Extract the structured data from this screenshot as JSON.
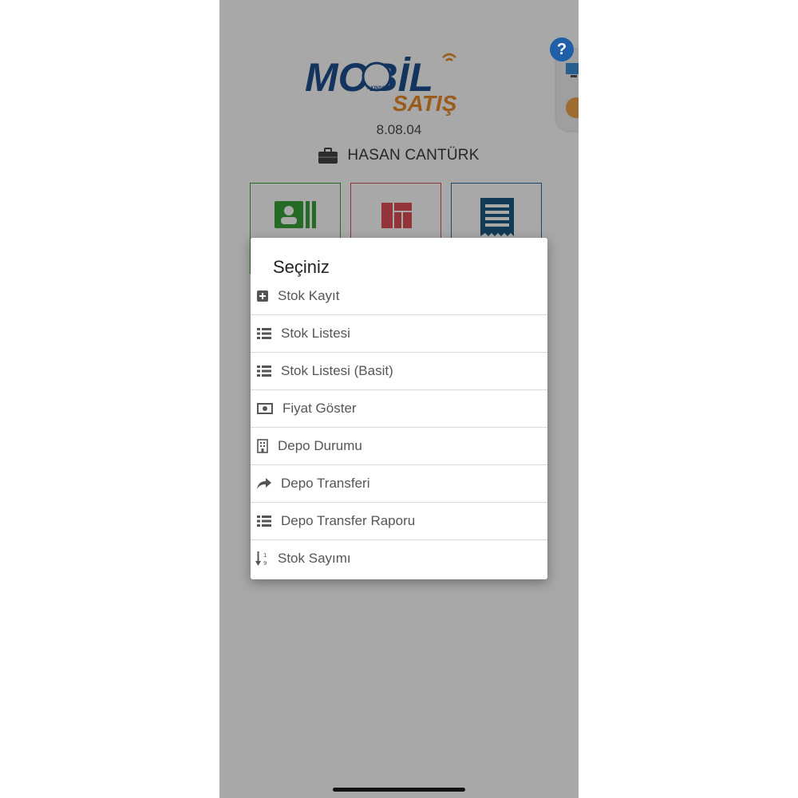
{
  "app": {
    "logo_word1": "MOBİL",
    "logo_word2": "SATIŞ",
    "logo_brand": "AKINSOFT",
    "version": "8.08.04",
    "user_name": "HASAN CANTÜRK",
    "help_label": "?"
  },
  "colors": {
    "logo_blue": "#1e4f8c",
    "logo_orange": "#e98c2a",
    "tile_green": "#39a33a",
    "tile_red": "#e0505a",
    "tile_blue": "#2b6ea8"
  },
  "tiles": [
    {
      "icon": "contact-card-icon"
    },
    {
      "icon": "dashboard-icon"
    },
    {
      "icon": "receipt-icon"
    }
  ],
  "dialog": {
    "title": "Seçiniz",
    "items": [
      {
        "label": "Stok Kayıt",
        "icon": "plus-square-icon"
      },
      {
        "label": "Stok Listesi",
        "icon": "list-icon"
      },
      {
        "label": "Stok Listesi (Basit)",
        "icon": "list-icon"
      },
      {
        "label": "Fiyat Göster",
        "icon": "money-icon"
      },
      {
        "label": "Depo Durumu",
        "icon": "building-icon"
      },
      {
        "label": "Depo Transferi",
        "icon": "share-arrow-icon"
      },
      {
        "label": "Depo Transfer Raporu",
        "icon": "list-icon"
      },
      {
        "label": "Stok Sayımı",
        "icon": "sort-numeric-icon"
      }
    ]
  }
}
